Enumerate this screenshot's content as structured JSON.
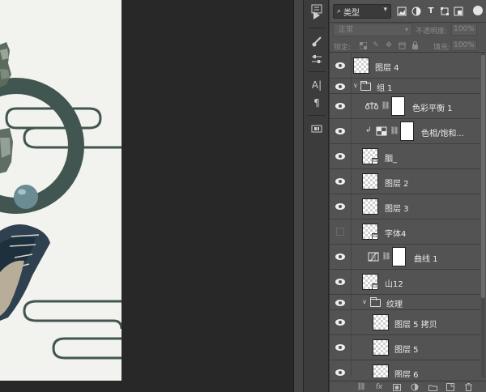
{
  "filter": {
    "kind_label": "类型",
    "icons": [
      "image-filter-icon",
      "adjustment-filter-icon",
      "type-filter-icon",
      "shape-filter-icon",
      "smart-object-filter-icon"
    ]
  },
  "blend": {
    "mode": "正常",
    "opacity_label": "不透明度:",
    "opacity_value": "100%"
  },
  "lock": {
    "label": "锁定:",
    "fill_label": "填充:",
    "fill_value": "100%"
  },
  "toolstrip": {
    "type_tool_glyph": "A|",
    "paragraph_glyph": "¶"
  },
  "layers": [
    {
      "name": "图层 4",
      "kind": "pixel",
      "visible": true
    },
    {
      "name": "组 1",
      "kind": "group",
      "visible": true,
      "expanded": true
    },
    {
      "name": "色彩平衡 1",
      "kind": "adjustment",
      "icon": "color-balance-icon",
      "visible": true
    },
    {
      "name": "色相/饱和...",
      "kind": "adjustment",
      "icon": "hue-saturation-icon",
      "clipped": true,
      "visible": true
    },
    {
      "name": "胭_",
      "kind": "smart",
      "visible": true
    },
    {
      "name": "图层 2",
      "kind": "pixel",
      "visible": true
    },
    {
      "name": "图层 3",
      "kind": "pixel",
      "visible": true
    },
    {
      "name": "字体4",
      "kind": "smart",
      "visible": false
    },
    {
      "name": "曲线 1",
      "kind": "adjustment",
      "icon": "curves-icon",
      "visible": true
    },
    {
      "name": "山12",
      "kind": "smart",
      "visible": true
    },
    {
      "name": "纹理",
      "kind": "group",
      "visible": true,
      "expanded": true
    },
    {
      "name": "图层 5 拷贝",
      "kind": "pixel",
      "visible": true
    },
    {
      "name": "图层 5",
      "kind": "pixel",
      "visible": true
    },
    {
      "name": "图层 6",
      "kind": "pixel",
      "visible": true
    }
  ],
  "colors": {
    "canvas_bg": "#f2f3ee",
    "ring": "#415651",
    "panel_bg": "#535353",
    "pasteboard": "#282828"
  }
}
